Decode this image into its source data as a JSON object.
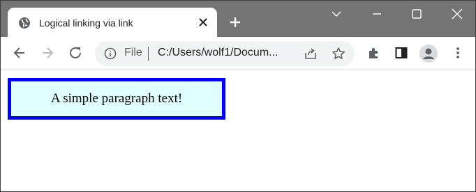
{
  "tab": {
    "title": "Logical linking via link"
  },
  "omnibox": {
    "scheme": "File",
    "url": "C:/Users/wolf1/Docum..."
  },
  "content": {
    "paragraph": "A simple paragraph text!"
  },
  "colors": {
    "tabstrip": "#747474",
    "box_border": "#0000ff",
    "box_background": "#e0ffff"
  },
  "icons": [
    "globe-icon",
    "close-icon",
    "plus-icon",
    "chevron-down-icon",
    "minimize-icon",
    "maximize-icon",
    "window-close-icon",
    "back-icon",
    "forward-icon",
    "reload-icon",
    "info-icon",
    "share-icon",
    "star-icon",
    "extensions-icon",
    "side-panel-icon",
    "profile-icon",
    "menu-icon"
  ]
}
